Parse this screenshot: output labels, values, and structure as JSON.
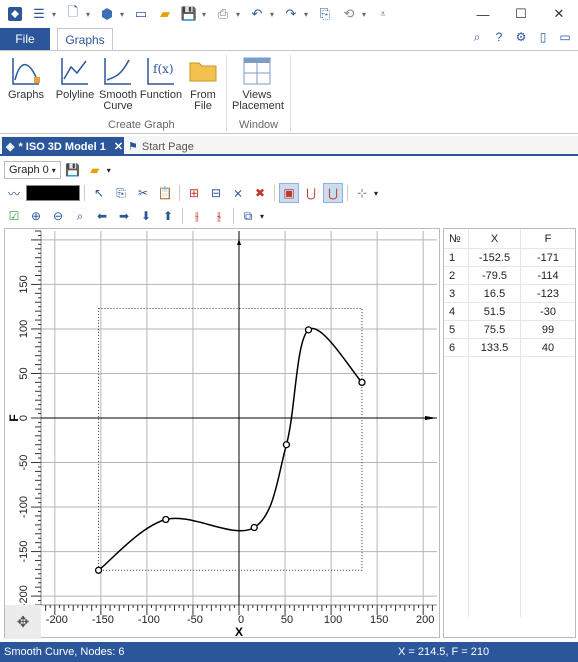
{
  "ribbon_tabs": {
    "file": "File",
    "graphs": "Graphs"
  },
  "ribbon": {
    "buttons": [
      {
        "label": "Graphs"
      },
      {
        "label": "Polyline"
      },
      {
        "label": "Smooth Curve"
      },
      {
        "label": "Function"
      },
      {
        "label": "From File"
      },
      {
        "label": "Views Placement"
      }
    ],
    "groups": {
      "create_graph": "Create Graph",
      "window": "Window"
    }
  },
  "doc_tabs": {
    "active": "* ISO 3D Model 1",
    "other": "Start Page"
  },
  "toolbar": {
    "graph_combo": "Graph 0",
    "line_color": "#000000"
  },
  "graph": {
    "x_axis_label": "X",
    "y_axis_label": "F",
    "x_ticks": [
      "-200",
      "-150",
      "-100",
      "-50",
      "0",
      "50",
      "100",
      "150",
      "200"
    ],
    "y_ticks": [
      "-200",
      "-150",
      "-100",
      "-50",
      "0",
      "50",
      "100",
      "150"
    ]
  },
  "chart_data": {
    "type": "line",
    "xlabel": "X",
    "ylabel": "F",
    "xlim": [
      -215,
      215
    ],
    "ylim": [
      -210,
      210
    ],
    "grid": true,
    "nodes": {
      "x": [
        -152.5,
        -79.5,
        16.5,
        51.5,
        75.5,
        133.5
      ],
      "y": [
        -171,
        -114,
        -123,
        -30,
        99,
        40
      ]
    }
  },
  "table": {
    "headers": [
      "№",
      "X",
      "F"
    ],
    "rows": [
      [
        "1",
        "-152.5",
        "-171"
      ],
      [
        "2",
        "-79.5",
        "-114"
      ],
      [
        "3",
        "16.5",
        "-123"
      ],
      [
        "4",
        "51.5",
        "-30"
      ],
      [
        "5",
        "75.5",
        "99"
      ],
      [
        "6",
        "133.5",
        "40"
      ]
    ]
  },
  "status": {
    "left": "Smooth Curve, Nodes: 6",
    "right": "X = 214.5, F = 210"
  },
  "colors": {
    "accent": "#2b579a"
  }
}
